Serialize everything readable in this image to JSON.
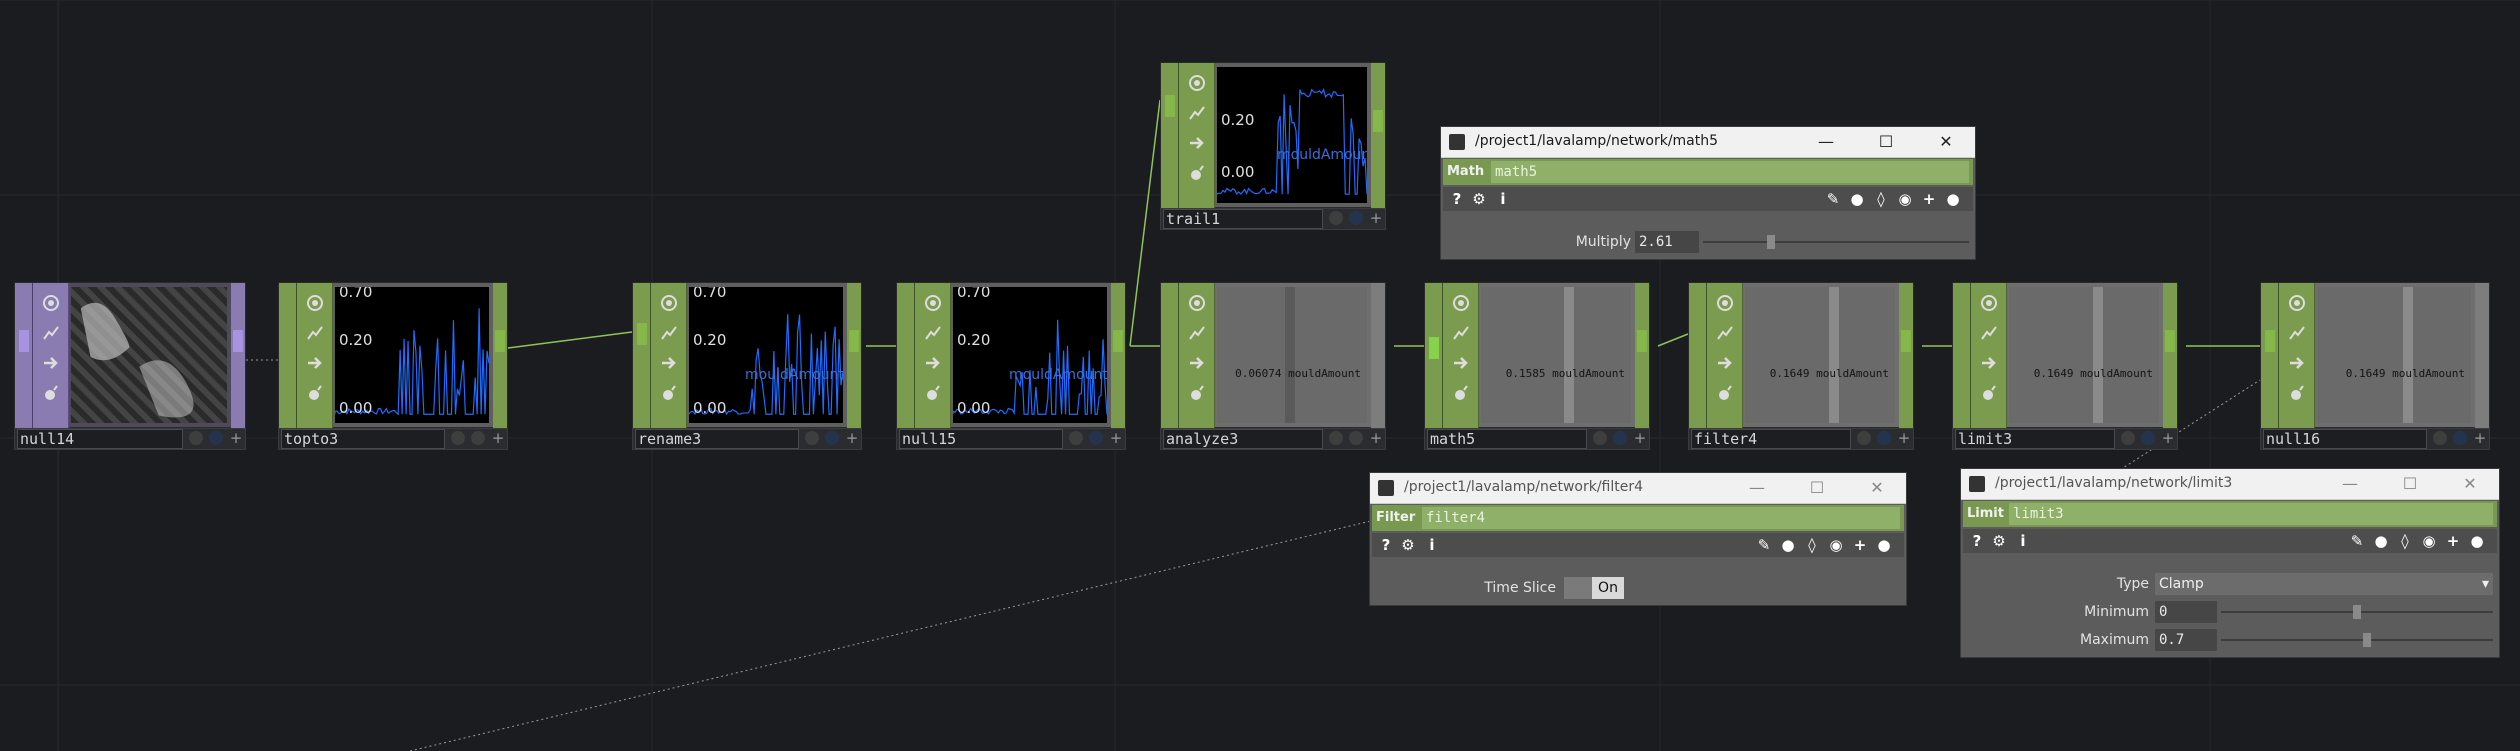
{
  "colors": {
    "background": "#1b1c1f",
    "chop_green": "#7b9c4f",
    "top_purple": "#8a7bb1",
    "wire": "#8fc35a",
    "plot_blue": "#1f6cff"
  },
  "nodes": [
    {
      "id": "null14",
      "label": "null14"
    },
    {
      "id": "topto3",
      "label": "topto3",
      "ticks": [
        "0.70",
        "0.20",
        "0.00"
      ]
    },
    {
      "id": "rename3",
      "label": "rename3",
      "ticks": [
        "0.70",
        "0.20",
        "0.00"
      ],
      "channel": "mouldAmount"
    },
    {
      "id": "null15",
      "label": "null15",
      "ticks": [
        "0.70",
        "0.20",
        "0.00"
      ],
      "channel": "mouldAmount"
    },
    {
      "id": "trail1",
      "label": "trail1",
      "ticks": [
        "0.20",
        "0.00"
      ],
      "channel": "mouldAmount"
    },
    {
      "id": "analyze3",
      "label": "analyze3",
      "value_text": "0.06074 mouldAmount"
    },
    {
      "id": "math5",
      "label": "math5",
      "value_text": "0.1585 mouldAmount"
    },
    {
      "id": "filter4",
      "label": "filter4",
      "value_text": "0.1649 mouldAmount"
    },
    {
      "id": "limit3",
      "label": "limit3",
      "value_text": "0.1649 mouldAmount"
    },
    {
      "id": "null16",
      "label": "null16",
      "value_text": "0.1649 mouldAmount"
    }
  ],
  "dialogs": {
    "math5": {
      "title": "/project1/lavalamp/network/math5",
      "op_type": "Math",
      "op_name": "math5",
      "params": {
        "multiply_label": "Multiply",
        "multiply_value": "2.61"
      }
    },
    "filter4": {
      "title": "/project1/lavalamp/network/filter4",
      "op_type": "Filter",
      "op_name": "filter4",
      "params": {
        "timeslice_label": "Time Slice",
        "timeslice_value": "On"
      }
    },
    "limit3": {
      "title": "/project1/lavalamp/network/limit3",
      "op_type": "Limit",
      "op_name": "limit3",
      "params": {
        "type_label": "Type",
        "type_value": "Clamp",
        "minimum_label": "Minimum",
        "minimum_value": "0",
        "maximum_label": "Maximum",
        "maximum_value": "0.7"
      }
    }
  },
  "toolbar_glyphs": {
    "help": "?",
    "info": "i"
  }
}
